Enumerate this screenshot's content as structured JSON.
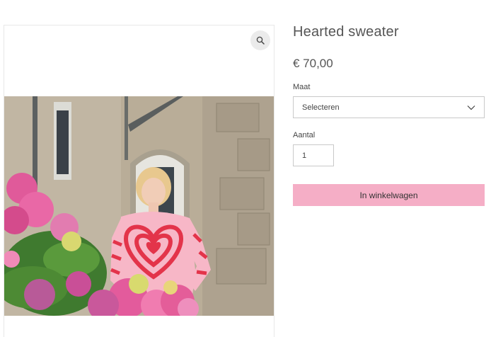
{
  "product": {
    "title": "Hearted sweater",
    "price": "€ 70,00",
    "image_alt": "Woman in a pink and red heart-pattern sweater standing among pink hydrangeas in front of a stone building"
  },
  "gallery": {
    "zoom_icon": "magnifier-icon"
  },
  "options": {
    "size_label": "Maat",
    "size_value": "Selecteren",
    "quantity_label": "Aantal",
    "quantity_value": "1"
  },
  "actions": {
    "add_to_cart_label": "In winkelwagen"
  },
  "colors": {
    "cart_button_bg": "#f5aec6",
    "heart_red": "#e3344a",
    "heart_pink": "#f7b7c7"
  }
}
